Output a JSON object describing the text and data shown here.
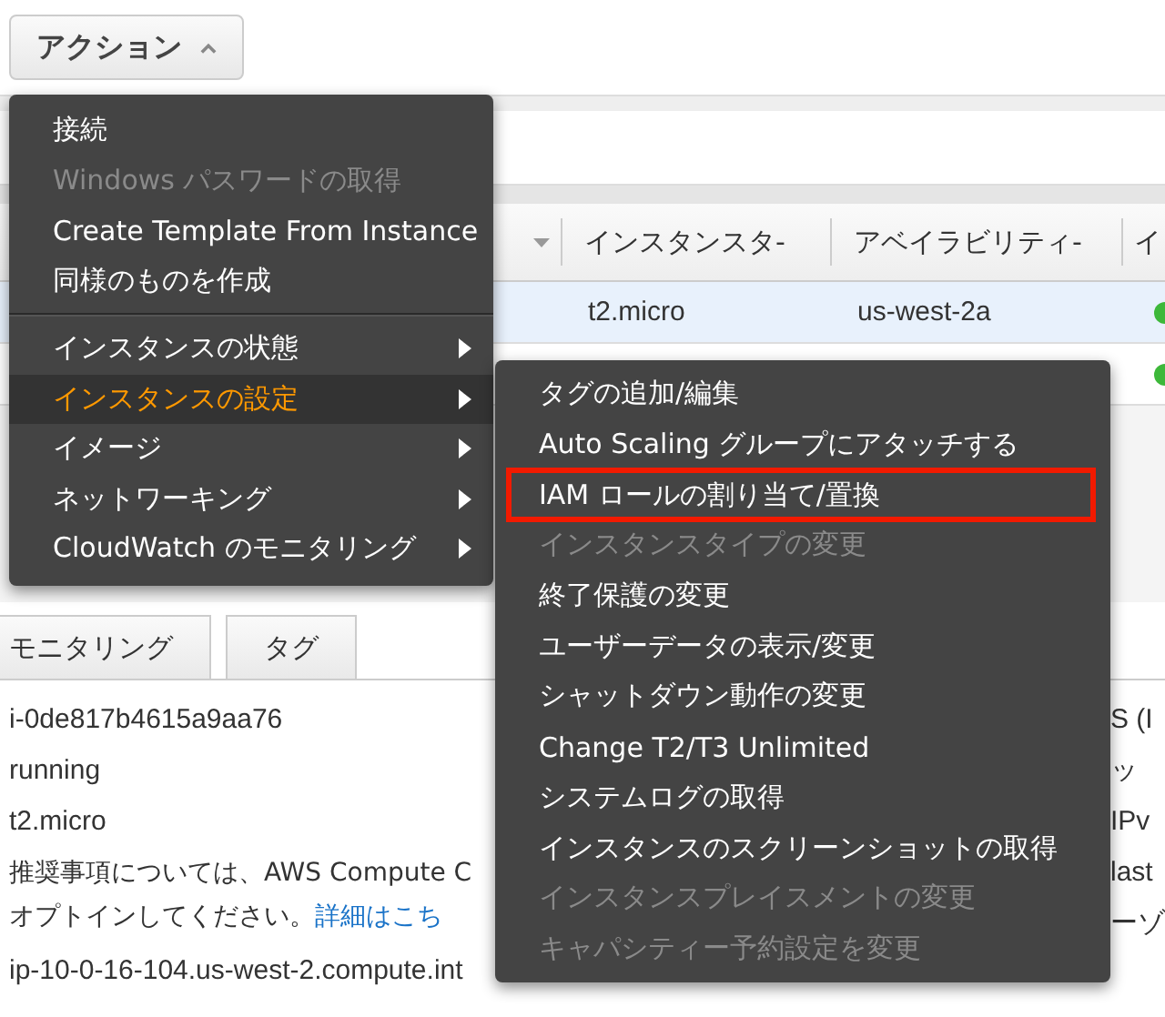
{
  "actions_button": {
    "label": "アクション",
    "expanded": true
  },
  "table": {
    "columns": [
      {
        "label": "インスタンスタ-"
      },
      {
        "label": "アベイラビリティ-"
      },
      {
        "label": "イ"
      }
    ],
    "rows": [
      {
        "selected": true,
        "cells": [
          "t2.micro",
          "us-west-2a"
        ],
        "color": "#3db83a"
      },
      {
        "selected": false,
        "color": "#3db83a"
      }
    ]
  },
  "detail_tabs": [
    {
      "label": "モニタリング",
      "selected": false
    },
    {
      "label": "タグ",
      "selected": false
    }
  ],
  "details": {
    "values": [
      "i-0de817b4615a9aa76",
      "running",
      "t2.micro"
    ],
    "note": {
      "line1": "推奨事項については、AWS Compute C",
      "line2": "オプトインしてください。",
      "link": "詳細はこち"
    },
    "dns": "ip-10-0-16-104.us-west-2.compute.int",
    "side_values": [
      "S (I",
      "ッ",
      "IPv",
      "last",
      "ーゾ"
    ]
  },
  "action_menu": {
    "sections": [
      [
        {
          "label": "接続",
          "disabled": false,
          "submenu": false,
          "selected": false
        },
        {
          "label": "Windows パスワードの取得",
          "disabled": true,
          "submenu": false,
          "selected": false
        },
        {
          "label": "Create Template From Instance",
          "disabled": false,
          "submenu": false,
          "selected": false
        },
        {
          "label": "同様のものを作成",
          "disabled": false,
          "submenu": false,
          "selected": false
        }
      ],
      [
        {
          "label": "インスタンスの状態",
          "disabled": false,
          "submenu": true,
          "selected": false
        },
        {
          "label": "インスタンスの設定",
          "disabled": false,
          "submenu": true,
          "selected": true
        },
        {
          "label": "イメージ",
          "disabled": false,
          "submenu": true,
          "selected": false
        },
        {
          "label": "ネットワーキング",
          "disabled": false,
          "submenu": true,
          "selected": false
        },
        {
          "label": "CloudWatch のモニタリング",
          "disabled": false,
          "submenu": true,
          "selected": false
        }
      ]
    ]
  },
  "settings_submenu": {
    "items": [
      {
        "label": "タグの追加/編集",
        "disabled": false,
        "highlighted": false
      },
      {
        "label": "Auto Scaling グループにアタッチする",
        "disabled": false,
        "highlighted": false
      },
      {
        "label": "IAM ロールの割り当て/置換",
        "disabled": false,
        "highlighted": true
      },
      {
        "label": "インスタンスタイプの変更",
        "disabled": true,
        "highlighted": false
      },
      {
        "label": "終了保護の変更",
        "disabled": false,
        "highlighted": false
      },
      {
        "label": "ユーザーデータの表示/変更",
        "disabled": false,
        "highlighted": false
      },
      {
        "label": "シャットダウン動作の変更",
        "disabled": false,
        "highlighted": false
      },
      {
        "label": "Change T2/T3 Unlimited",
        "disabled": false,
        "highlighted": false
      },
      {
        "label": "システムログの取得",
        "disabled": false,
        "highlighted": false
      },
      {
        "label": "インスタンスのスクリーンショットの取得",
        "disabled": false,
        "highlighted": false
      },
      {
        "label": "インスタンスプレイスメントの変更",
        "disabled": true,
        "highlighted": false
      },
      {
        "label": "キャパシティー予約設定を変更",
        "disabled": true,
        "highlighted": false
      }
    ]
  }
}
